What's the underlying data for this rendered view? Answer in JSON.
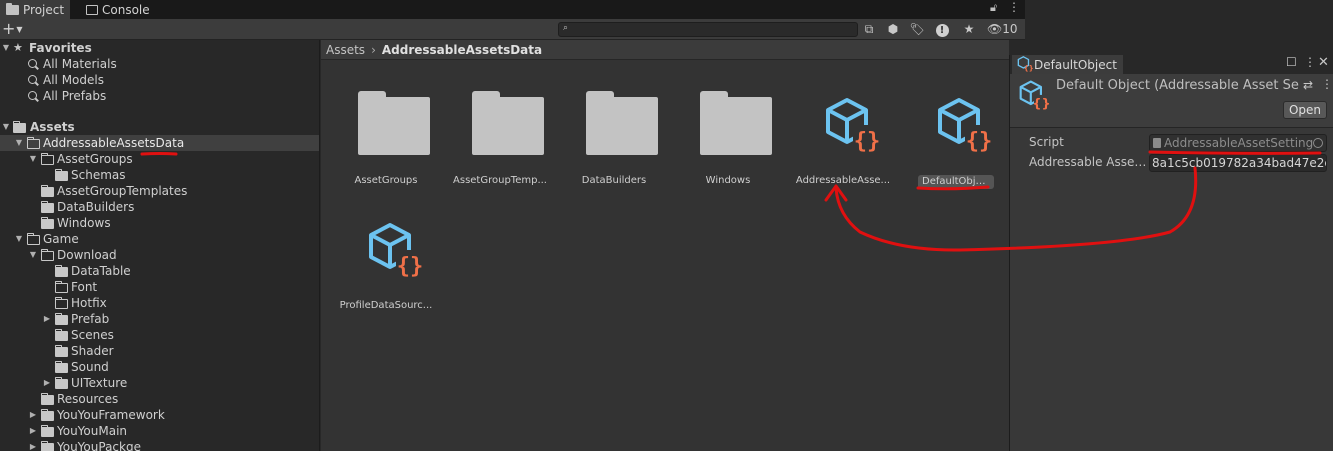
{
  "tabs": [
    {
      "label": "Project",
      "icon": "folder-icon"
    },
    {
      "label": "Console",
      "icon": "console-icon"
    }
  ],
  "toolbar": {
    "add_label": "+",
    "search_placeholder": "",
    "hidden_count": "10"
  },
  "tree": {
    "favorites_label": "Favorites",
    "favorites": [
      "All Materials",
      "All Models",
      "All Prefabs"
    ],
    "assets_label": "Assets",
    "items": [
      {
        "label": "AddressableAssetsData"
      },
      {
        "label": "AssetGroups"
      },
      {
        "label": "Schemas"
      },
      {
        "label": "AssetGroupTemplates"
      },
      {
        "label": "DataBuilders"
      },
      {
        "label": "Windows"
      },
      {
        "label": "Game"
      },
      {
        "label": "Download"
      },
      {
        "label": "DataTable"
      },
      {
        "label": "Font"
      },
      {
        "label": "Hotfix"
      },
      {
        "label": "Prefab"
      },
      {
        "label": "Scenes"
      },
      {
        "label": "Shader"
      },
      {
        "label": "Sound"
      },
      {
        "label": "UITexture"
      },
      {
        "label": "Resources"
      },
      {
        "label": "YouYouFramework"
      },
      {
        "label": "YouYouMain"
      },
      {
        "label": "YouYouPackge"
      }
    ]
  },
  "breadcrumb": {
    "root": "Assets",
    "current": "AddressableAssetsData"
  },
  "grid": {
    "items": [
      {
        "label": "AssetGroups",
        "type": "folder"
      },
      {
        "label": "AssetGroupTemp...",
        "type": "folder"
      },
      {
        "label": "DataBuilders",
        "type": "folder"
      },
      {
        "label": "Windows",
        "type": "folder"
      },
      {
        "label": "AddressableAsse...",
        "type": "scriptable-object"
      },
      {
        "label": "DefaultObject",
        "type": "scriptable-object",
        "selected": true
      },
      {
        "label": "ProfileDataSourc...",
        "type": "scriptable-object"
      }
    ]
  },
  "inspector": {
    "tab_label": "DefaultObject",
    "title": "Default Object (Addressable Asset Se",
    "open_label": "Open",
    "props": [
      {
        "label": "Script",
        "value": "AddressableAssetSetting"
      },
      {
        "label": "Addressable Asset...",
        "value": "8a1c5cb019782a34bad47e2e"
      }
    ]
  },
  "colors": {
    "annotation": "#e01010",
    "so_cube": "#6cc3f0",
    "so_brace": "#f07048"
  }
}
